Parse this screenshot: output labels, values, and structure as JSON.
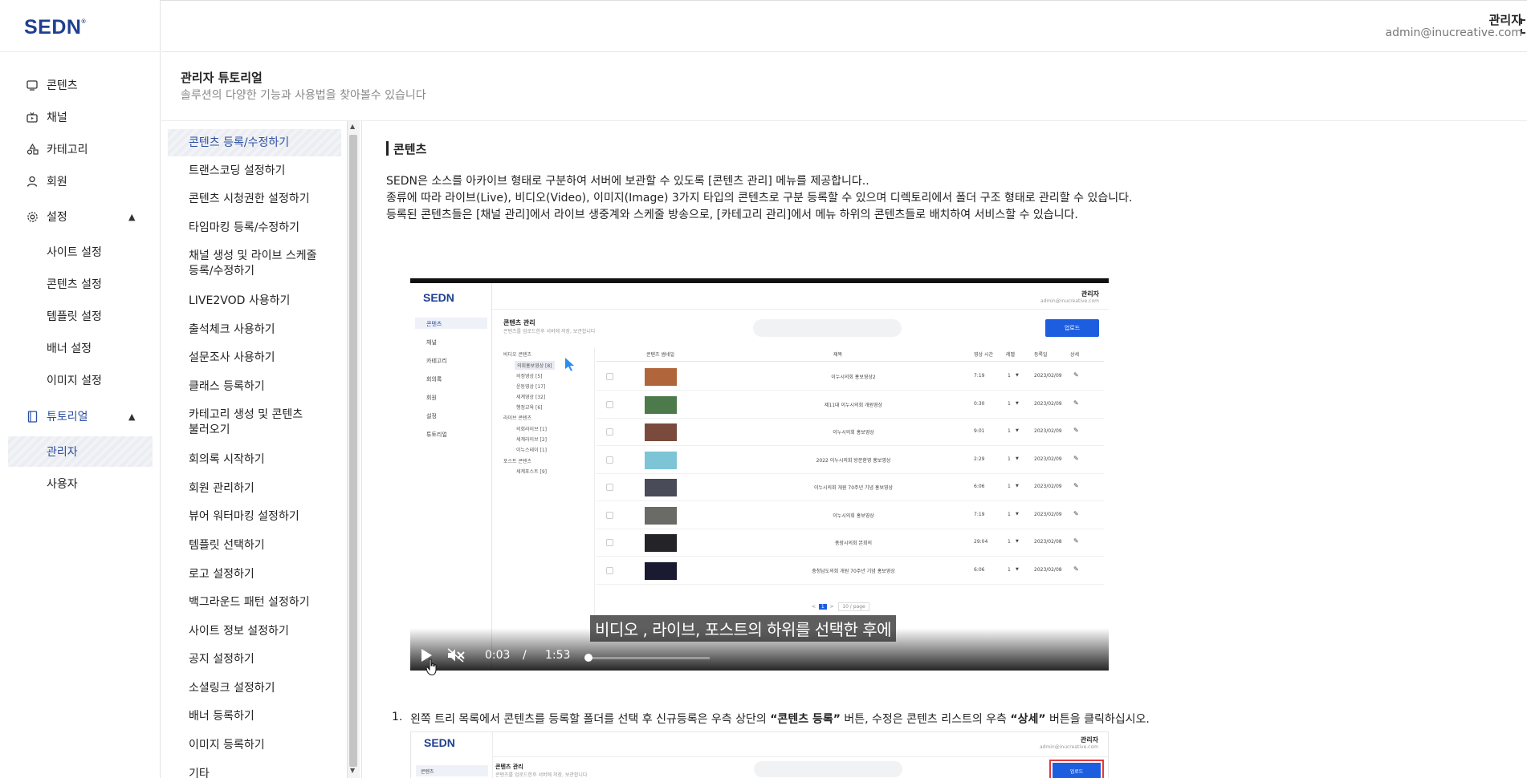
{
  "brand": {
    "logo": "SEDN",
    "logo_mark": "®",
    "accent": "#2a4fa0",
    "logo_color": "#1f3f91"
  },
  "header": {
    "user_name": "관리자",
    "user_email": "admin@inucreative.com"
  },
  "sidebar": {
    "items": [
      {
        "label": "콘텐츠",
        "icon": "monitor-icon"
      },
      {
        "label": "채널",
        "icon": "tv-icon"
      },
      {
        "label": "카테고리",
        "icon": "shapes-icon"
      },
      {
        "label": "회원",
        "icon": "user-icon"
      },
      {
        "label": "설정",
        "icon": "gear-icon"
      }
    ],
    "settings_sub": [
      "사이트 설정",
      "콘텐츠 설정",
      "템플릿 설정",
      "배너 설정",
      "이미지 설정"
    ],
    "tutorial": {
      "label": "튜토리얼",
      "icon": "book-icon"
    },
    "tutorial_sub": [
      "관리자",
      "사용자"
    ]
  },
  "page": {
    "title": "관리자 튜토리얼",
    "subtitle": "솔루션의 다양한 기능과 사용법을 찾아볼수 있습니다"
  },
  "tutorials": [
    "콘텐츠 등록/수정하기",
    "트랜스코딩 설정하기",
    "콘텐츠 시청권한 설정하기",
    "타임마킹 등록/수정하기",
    "채널 생성 및 라이브 스케줄 등록/수정하기",
    "LIVE2VOD 사용하기",
    "출석체크 사용하기",
    "설문조사 사용하기",
    "클래스 등록하기",
    "카테고리 생성 및 콘텐츠 불러오기",
    "회의록 시작하기",
    "회원 관리하기",
    "뷰어 워터마킹 설정하기",
    "템플릿 선택하기",
    "로고 설정하기",
    "백그라운드 패턴 설정하기",
    "사이트 정보 설정하기",
    "공지 설정하기",
    "소셜링크 설정하기",
    "배너 등록하기",
    "이미지 등록하기",
    "기타"
  ],
  "content": {
    "section_title": "콘텐츠",
    "paragraphs": [
      "SEDN은 소스를 아카이브 형태로 구분하여 서버에 보관할 수 있도록 [콘텐츠 관리] 메뉴를 제공합니다..",
      "종류에 따라 라이브(Live), 비디오(Video), 이미지(Image) 3가지 타입의 콘텐츠로 구분 등록할 수 있으며 디렉토리에서 폴더 구조 형태로 관리할 수 있습니다.",
      "등록된 콘텐츠들은 [채널 관리]에서 라이브 생중계와 스케줄 방송으로, [카테고리 관리]에서 메뉴 하위의 콘텐츠들로 배치하여 서비스할 수 있습니다."
    ],
    "step1": {
      "num": "1.",
      "pre": "왼쪽 트리 목록에서 콘텐츠를 등록할 폴더를 선택 후 신규등록은 우측 상단의 ",
      "b1": "“콘텐츠 등록”",
      "mid": " 버튼, 수정은 콘텐츠 리스트의 우측 ",
      "b2": "“상세”",
      "post": " 버튼을 클릭하십시오."
    }
  },
  "video": {
    "caption": "비디오 , 라이브, 포스트의 하위를 선택한 후에",
    "current_time": "0:03",
    "separator": "/",
    "duration": "1:53",
    "progress": 0.027,
    "inner": {
      "logo": "SEDN",
      "admin": "관리자",
      "admin_email": "admin@inucreative.com",
      "nav": [
        "콘텐츠",
        "채널",
        "카테고리",
        "회의록",
        "회원",
        "설정",
        "튜토리얼"
      ],
      "title": "콘텐츠 관리",
      "subtitle": "콘텐츠를 업로드한후 서버에 저장, 보관합니다",
      "upload": "업로드",
      "tree": [
        "비디오 콘텐츠",
        "의회홍보영상 [8]",
        "의정영상 [5]",
        "운동영상 [17]",
        "세계영상 [32]",
        "행정교육 [6]",
        "라이브 콘텐츠",
        "의회라이브 [1]",
        "세계라이브 [2]",
        "이누스테이 [1]",
        "포스트 콘텐츠",
        "세계포스트 [9]"
      ],
      "headers": [
        "콘텐츠 썸네일",
        "제목",
        "영상 시간",
        "레벨",
        "등록일",
        "상세"
      ],
      "rows": [
        {
          "title": "이누시의회 홍보영상2",
          "time": "7:19",
          "level": "1",
          "date": "2023/02/09",
          "color": "#b0663a"
        },
        {
          "title": "제11대 이누시의회 개원영상",
          "time": "0:30",
          "level": "1",
          "date": "2023/02/09",
          "color": "#4d7a4b"
        },
        {
          "title": "이누시의회 홍보영상",
          "time": "9:01",
          "level": "1",
          "date": "2023/02/09",
          "color": "#7a4a3c"
        },
        {
          "title": "2022 이누시의회 방문환영 홍보영상",
          "time": "2:29",
          "level": "1",
          "date": "2023/02/09",
          "color": "#7cc4d6"
        },
        {
          "title": "이누시의회 개원 70주년 기념 홍보영상",
          "time": "6:06",
          "level": "1",
          "date": "2023/02/09",
          "color": "#4a4b58"
        },
        {
          "title": "이누시의회 홍보영상",
          "time": "7:19",
          "level": "1",
          "date": "2023/02/09",
          "color": "#6a6a66"
        },
        {
          "title": "총장시의회 본회의",
          "time": "29:04",
          "level": "1",
          "date": "2023/02/08",
          "color": "#242428"
        },
        {
          "title": "충청남도의회 개원 70주년 기념 홍보영상",
          "time": "6:06",
          "level": "1",
          "date": "2023/02/08",
          "color": "#1a1a30"
        }
      ],
      "page": "1",
      "per_page": "10 / page"
    }
  },
  "shot2": {
    "logo": "SEDN",
    "admin": "관리자",
    "admin_email": "admin@inucreative.com",
    "title": "콘텐츠 관리",
    "subtitle": "콘텐츠를 업로드한후 서버에 저장, 보관합니다",
    "nav": "콘텐츠",
    "upload": "업로드"
  }
}
